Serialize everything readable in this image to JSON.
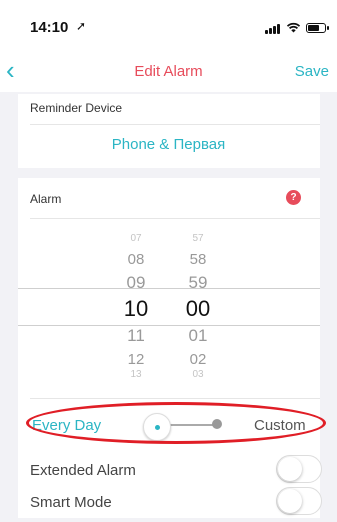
{
  "status_bar": {
    "time": "14:10",
    "location_icon": "location-arrow-icon",
    "signal_icon": "signal-icon",
    "wifi_icon": "wifi-icon",
    "battery_icon": "battery-icon"
  },
  "nav": {
    "back_icon": "chevron-left-icon",
    "title": "Edit Alarm",
    "save_label": "Save"
  },
  "reminder": {
    "label": "Reminder Device",
    "device": "Phone & Первая"
  },
  "alarm": {
    "label": "Alarm",
    "help_icon": "question-icon",
    "help_glyph": "?",
    "hours": [
      "07",
      "08",
      "09",
      "10",
      "11",
      "12",
      "13"
    ],
    "minutes": [
      "57",
      "58",
      "59",
      "00",
      "01",
      "02",
      "03"
    ],
    "selected_hour": "10",
    "selected_minute": "00"
  },
  "frequency": {
    "everyday_label": "Every Day",
    "custom_label": "Custom",
    "selected": "Every Day"
  },
  "toggles": [
    {
      "label": "Extended Alarm",
      "on": false
    },
    {
      "label": "Smart Mode",
      "on": false
    }
  ],
  "colors": {
    "accent": "#2bb5c4",
    "title": "#e74c5b",
    "annotation": "#e01e26"
  }
}
